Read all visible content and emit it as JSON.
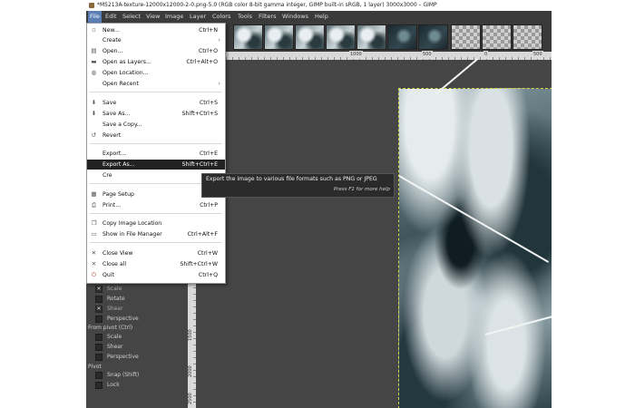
{
  "window": {
    "title": "*M5213A-texture-12000x12000-2-0.png-5.0 (RGB color 8-bit gamma integer, GIMP built-in sRGB, 1 layer) 3000x3000 – GIMP"
  },
  "menubar": {
    "items": [
      "File",
      "Edit",
      "Select",
      "View",
      "Image",
      "Layer",
      "Colors",
      "Tools",
      "Filters",
      "Windows",
      "Help"
    ]
  },
  "file_menu": {
    "items": [
      {
        "label": "New...",
        "accel": "Ctrl+N"
      },
      {
        "label": "Create",
        "accel": ""
      },
      {
        "label": "Open...",
        "accel": "Ctrl+O"
      },
      {
        "label": "Open as Layers...",
        "accel": "Ctrl+Alt+O"
      },
      {
        "label": "Open Location...",
        "accel": ""
      },
      {
        "label": "Open Recent",
        "accel": ""
      },
      {
        "label": "Save",
        "accel": "Ctrl+S"
      },
      {
        "label": "Save As...",
        "accel": "Shift+Ctrl+S"
      },
      {
        "label": "Save a Copy...",
        "accel": ""
      },
      {
        "label": "Revert",
        "accel": ""
      },
      {
        "label": "Export...",
        "accel": "Ctrl+E"
      },
      {
        "label": "Export As...",
        "accel": "Shift+Ctrl+E"
      },
      {
        "label": "Cre",
        "accel": ""
      },
      {
        "label": "Page Setup",
        "accel": ""
      },
      {
        "label": "Print...",
        "accel": "Ctrl+P"
      },
      {
        "label": "Copy Image Location",
        "accel": ""
      },
      {
        "label": "Show in File Manager",
        "accel": "Ctrl+Alt+F"
      },
      {
        "label": "Close View",
        "accel": "Ctrl+W"
      },
      {
        "label": "Close all",
        "accel": "Shift+Ctrl+W"
      },
      {
        "label": "Quit",
        "accel": "Ctrl+Q"
      }
    ]
  },
  "tooltip": {
    "text": "Export the image to various file formats such as PNG or JPEG",
    "help": "Press F1 for more help"
  },
  "ruler": {
    "top_labels": [
      "1000",
      "500",
      "0",
      "500"
    ],
    "left_labels": [
      "1500",
      "2000",
      "2500"
    ]
  },
  "tool_options": {
    "items": [
      {
        "label": "Scale",
        "checked": true
      },
      {
        "label": "Rotate",
        "checked": false
      },
      {
        "label": "Shear",
        "checked": true
      },
      {
        "label": "Perspective",
        "checked": false
      }
    ],
    "pivot_header": "From pivot  (Ctrl)",
    "pivot_items": [
      {
        "label": "Scale",
        "checked": false
      },
      {
        "label": "Shear",
        "checked": false
      },
      {
        "label": "Perspective",
        "checked": false
      }
    ],
    "pivot2_header": "Pivot",
    "pivot2_items": [
      {
        "label": "Snap (Shift)",
        "checked": false
      },
      {
        "label": "Lock",
        "checked": false
      }
    ]
  },
  "colors": {
    "menu_highlight": "#222222",
    "menubar_active": "#5b7fb5",
    "selection_border": "#d6d64a"
  }
}
